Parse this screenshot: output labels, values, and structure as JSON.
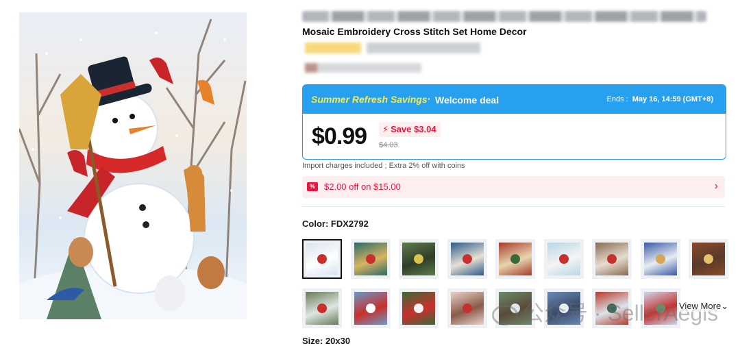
{
  "product": {
    "title": "Mosaic Embroidery Cross Stitch Set Home Decor"
  },
  "deal": {
    "name": "Summer Refresh Savings",
    "separator": "·",
    "welcome": "Welcome deal",
    "ends_label": "Ends :",
    "ends_value": "May 16, 14:59 (GMT+8)",
    "price": "$0.99",
    "save": "Save $3.04",
    "original_price": "$4.03"
  },
  "import_note": "Import charges included ; Extra 2% off with coins",
  "coupon": {
    "icon_text": "%",
    "text": "$2.00 off on $15.00",
    "arrow": "›"
  },
  "color": {
    "label": "Color: FDX2792"
  },
  "thumbnails": [
    {
      "name": "snowman-cardinal",
      "selected": true,
      "colors": [
        "#d9e4f1",
        "#c8302d",
        "#ffffff"
      ]
    },
    {
      "name": "stained-window",
      "selected": false,
      "colors": [
        "#2a6a6a",
        "#c8302d",
        "#d8b460"
      ]
    },
    {
      "name": "birds-branch",
      "selected": false,
      "colors": [
        "#5f7d4a",
        "#d9c34a",
        "#2f3d2a"
      ]
    },
    {
      "name": "red-lantern",
      "selected": false,
      "colors": [
        "#2a5a8a",
        "#c8302d",
        "#e8e0d4"
      ]
    },
    {
      "name": "window-gifts",
      "selected": false,
      "colors": [
        "#a83a2a",
        "#3a6a3a",
        "#e6d6b0"
      ]
    },
    {
      "name": "winter-house",
      "selected": false,
      "colors": [
        "#b8d6e6",
        "#c8302d",
        "#f4f4f4"
      ]
    },
    {
      "name": "cardinal-wreath",
      "selected": false,
      "colors": [
        "#8a6a52",
        "#c8302d",
        "#e6ddd2"
      ]
    },
    {
      "name": "bluebirds",
      "selected": false,
      "colors": [
        "#3a5aa6",
        "#d6a65a",
        "#e8ecf2"
      ]
    },
    {
      "name": "window-candles",
      "selected": false,
      "colors": [
        "#8a4a2a",
        "#e6c06a",
        "#5a3a2a"
      ]
    },
    {
      "name": "cardinal-cabin",
      "selected": false,
      "colors": [
        "#6a7a5a",
        "#c8302d",
        "#dde6e0"
      ]
    },
    {
      "name": "snowman-blue",
      "selected": false,
      "colors": [
        "#6a9ac8",
        "#ffffff",
        "#c8302d"
      ]
    },
    {
      "name": "snowman-wreath",
      "selected": false,
      "colors": [
        "#3a6a3a",
        "#f4f4f4",
        "#c8302d"
      ]
    },
    {
      "name": "santa-porch",
      "selected": false,
      "colors": [
        "#e6d2c8",
        "#c8302d",
        "#8a5a4a"
      ]
    },
    {
      "name": "winter-door",
      "selected": false,
      "colors": [
        "#6a8a6a",
        "#e0e6ea",
        "#5a4a3a"
      ]
    },
    {
      "name": "snowy-village",
      "selected": false,
      "colors": [
        "#6a8ab8",
        "#e8eef4",
        "#3a4a6a"
      ]
    },
    {
      "name": "red-door",
      "selected": false,
      "colors": [
        "#b83a2a",
        "#3a6a5a",
        "#dae4ea"
      ]
    },
    {
      "name": "birdhouse",
      "selected": false,
      "colors": [
        "#c8d8e8",
        "#6a8a6a",
        "#c8302d"
      ]
    }
  ],
  "view_more": "View More",
  "view_more_icon": "chevron-down-icon",
  "size_label": "Size: 20x30",
  "watermark": "公众号 · SellerAegis",
  "accent": "#28a0f0",
  "sale_color": "#e8143d"
}
